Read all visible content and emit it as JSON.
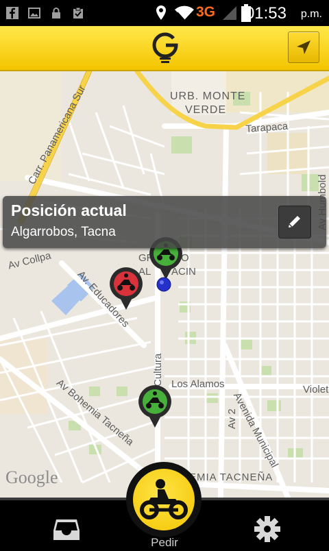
{
  "status_bar": {
    "network": "3G",
    "time": "01:53",
    "ampm": "p.m."
  },
  "app_bar": {
    "logo_icon": "g-bulb-logo",
    "location_button_icon": "navigation-arrow-icon"
  },
  "map": {
    "labels": {
      "urb": "URB. MONTE",
      "verde": "VERDE",
      "tarapaca": "Tarapaca",
      "panamericana": "Carr. Panamericana Sur",
      "humboldt": "Av Humbold",
      "collpa": "Av Collpa",
      "educadores": "Av. Educadores",
      "gran_line1": "GR",
      "gran_line2": "O",
      "gran_line3": "AL",
      "gran_line4": "ACIN",
      "cultura": "Cultura",
      "alamos": "Los Alamos",
      "violet": "Violet",
      "av2": "Av 2",
      "municipal": "Avenida Municipal",
      "bohemia": "Av Bohemia Tacneña",
      "bohemia_h": "EMIA TACNEÑA"
    },
    "attribution": "Google"
  },
  "location_panel": {
    "title": "Posición actual",
    "address": "Algarrobos, Tacna"
  },
  "markers": [
    {
      "type": "moto",
      "status": "available",
      "color": "#46b03a"
    },
    {
      "type": "moto",
      "status": "busy",
      "color": "#d8323b"
    },
    {
      "type": "moto",
      "status": "available",
      "color": "#46b03a"
    }
  ],
  "bottom_bar": {
    "pedir_label": "Pedir",
    "inbox_icon": "inbox-icon",
    "settings_icon": "gear-icon"
  },
  "colors": {
    "accent": "#f4c400",
    "panel_bg": "#464646",
    "marker_green": "#46b03a",
    "marker_red": "#d8323b"
  }
}
